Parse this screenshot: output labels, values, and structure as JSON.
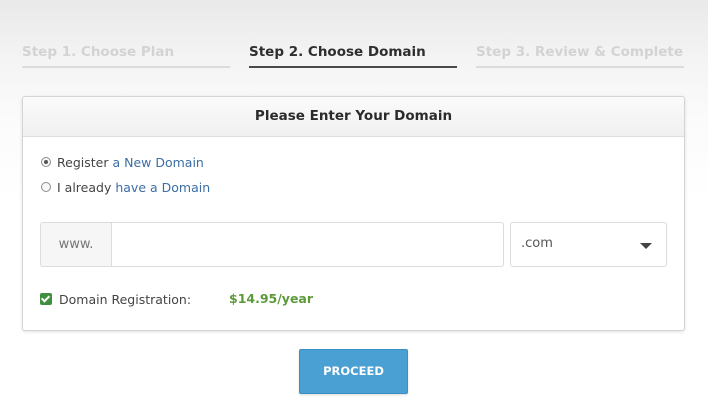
{
  "steps": [
    {
      "label": "Step 1. Choose Plan",
      "state": "inactive"
    },
    {
      "label": "Step 2. Choose Domain",
      "state": "active"
    },
    {
      "label": "Step 3. Review & Complete",
      "state": "inactive"
    }
  ],
  "panel": {
    "title": "Please Enter Your Domain",
    "options": [
      {
        "prefix": "Register",
        "link": "a New Domain",
        "selected": true
      },
      {
        "prefix": "I already",
        "link": "have a Domain",
        "selected": false
      }
    ],
    "domain": {
      "prefix": "www.",
      "value": "",
      "tld": ".com"
    },
    "registration": {
      "label": "Domain Registration:",
      "price": "$14.95/year",
      "checked": true
    }
  },
  "proceed_label": "PROCEED",
  "colors": {
    "link": "#3b6ea6",
    "price": "#5c9a3a",
    "button": "#4a9fd3",
    "checkbox": "#3f8f3f"
  }
}
